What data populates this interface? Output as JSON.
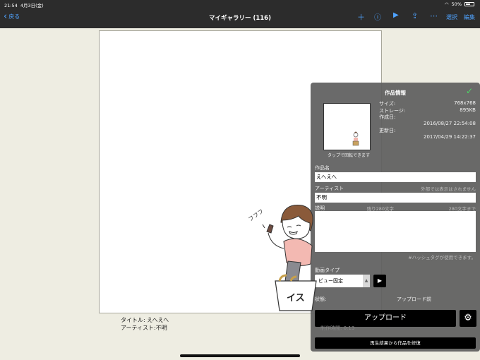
{
  "status": {
    "time": "21:54",
    "date": "4月3日(金)",
    "battery": "50%"
  },
  "nav": {
    "back": "戻る",
    "title": "マイギャラリー (116)",
    "add_icon": "plus-icon",
    "info_icon": "info-icon",
    "play_icon": "play-icon",
    "share_icon": "share-icon",
    "more_icon": "more-icon",
    "select": "選択",
    "edit": "編集"
  },
  "canvas": {
    "caption_title": "タイトル: えへえへ",
    "caption_artist": "アーティスト:不明",
    "doodle_text": "フフフ",
    "chair_text": "イス"
  },
  "panel": {
    "title": "作品情報",
    "size_label": "サイズ:",
    "size_value": "768x768",
    "storage_label": "ストレージ:",
    "storage_value": "895KB",
    "created_label": "作成日:",
    "created_value": "2016/08/27 22:54:08",
    "updated_label": "更新日:",
    "updated_value": "2017/04/29 14:22:37",
    "thumb_caption": "タップで回転できます",
    "name_label": "作品名",
    "name_value": "えへえへ",
    "artist_label": "アーティスト",
    "artist_note": "外部では表示はされません",
    "artist_value": "不明",
    "desc_label": "説明",
    "desc_remaining": "残り280文字",
    "desc_limit": "280文字まで",
    "hashtag_hint": "#ハッシュタグが使用できます。",
    "video_type_label": "動画タイプ",
    "video_type_value": "ビュー固定",
    "state_label": "状態:",
    "state_value": "アップロード前",
    "upload": "アップロード",
    "production_time": "制作時間: 0:13",
    "restore": "再生結果から作品を修復"
  },
  "colors": {
    "accent": "#4fa3ff",
    "check": "#4cd964"
  }
}
